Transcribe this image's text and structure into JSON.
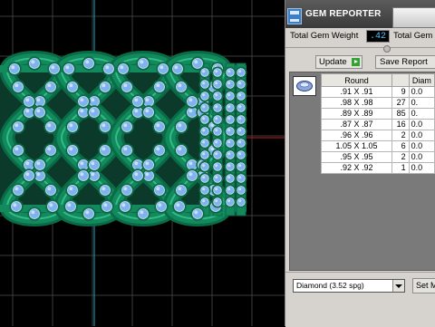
{
  "viewport": {
    "scene": "green gold filigree ring with bezel-set round stones",
    "colors": {
      "grid": "#3d3d3d",
      "axis_x": "#c81e1e",
      "axis_y": "#1ba8c4",
      "metal": "#138a5e",
      "stone": "#7fb3ee"
    }
  },
  "panel": {
    "title": "GEM REPORTER",
    "total_weight_label": "Total Gem Weight",
    "total_weight_value": ".42",
    "total_weight_label_2": "Total Gem",
    "update_label": "Update",
    "save_report_label": "Save Report",
    "table": {
      "columns": [
        "Round",
        "",
        "Diam"
      ],
      "rows": [
        {
          "size": ".91 X .91",
          "count": "9",
          "diam": "0.0"
        },
        {
          "size": ".98 X .98",
          "count": "27",
          "diam": "0."
        },
        {
          "size": ".89 X .89",
          "count": "85",
          "diam": "0."
        },
        {
          "size": ".87 X .87",
          "count": "16",
          "diam": "0.0"
        },
        {
          "size": ".96 X .96",
          "count": "2",
          "diam": "0.0"
        },
        {
          "size": "1.05 X 1.05",
          "count": "6",
          "diam": "0.0"
        },
        {
          "size": ".95 X .95",
          "count": "2",
          "diam": "0.0"
        },
        {
          "size": ".92 X .92",
          "count": "1",
          "diam": "0.0"
        }
      ]
    },
    "material_select_value": "Diamond      (3.52 spg)",
    "set_button_label": "Set M"
  }
}
